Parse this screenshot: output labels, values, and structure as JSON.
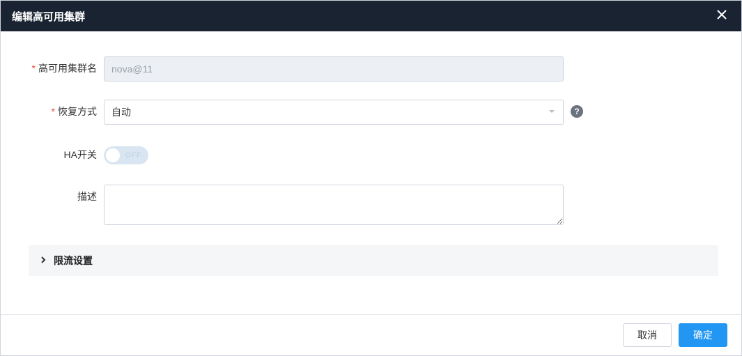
{
  "dialog": {
    "title": "编辑高可用集群"
  },
  "form": {
    "clusterName": {
      "label": "高可用集群名",
      "value": "nova@11"
    },
    "recoveryMode": {
      "label": "恢复方式",
      "value": "自动"
    },
    "haSwitch": {
      "label": "HA开关",
      "state": "OFF"
    },
    "description": {
      "label": "描述",
      "value": ""
    },
    "rateLimit": {
      "label": "限流设置"
    }
  },
  "footer": {
    "cancel": "取消",
    "confirm": "确定"
  }
}
